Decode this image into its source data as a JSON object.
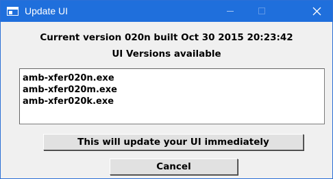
{
  "window": {
    "title": "Update UI"
  },
  "info": {
    "current_version": "Current version 020n built Oct 30 2015 20:23:42",
    "versions_heading": "UI Versions available"
  },
  "versions_list": {
    "items": [
      {
        "label": "amb-xfer020n.exe"
      },
      {
        "label": "amb-xfer020m.exe"
      },
      {
        "label": "amb-xfer020k.exe"
      }
    ]
  },
  "buttons": {
    "update_label": "This will update your UI immediately",
    "cancel_label": "Cancel"
  },
  "icons": {
    "app": "window-app-icon",
    "minimize": "minimize-icon",
    "maximize": "maximize-icon",
    "close": "close-icon"
  },
  "colors": {
    "titlebar": "#1f6fdc",
    "dialog_background": "#f0f0f0",
    "button_face": "#e1e1e1"
  }
}
